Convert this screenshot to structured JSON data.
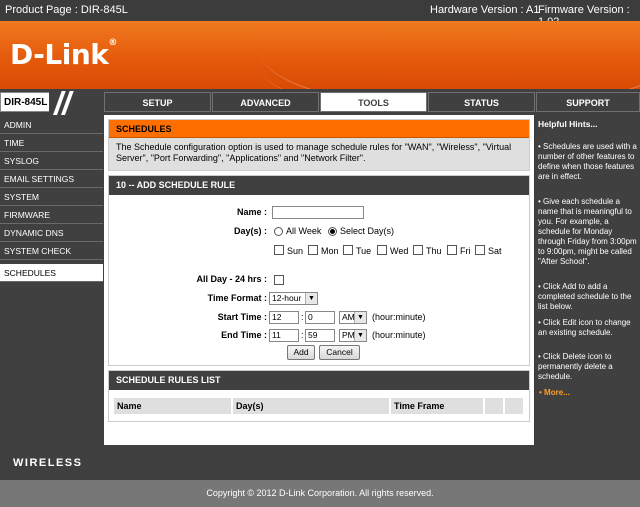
{
  "top_bar": {
    "product_page": "Product Page : DIR-845L",
    "hardware_version": "Hardware Version : A1",
    "firmware_version": "Firmware Version : 1.02"
  },
  "brand": {
    "logo": "D-Link",
    "reg": "®",
    "color": "#e85f10"
  },
  "model_label": "DIR-845L",
  "nav_tabs": [
    {
      "label": "SETUP"
    },
    {
      "label": "ADVANCED"
    },
    {
      "label": "TOOLS"
    },
    {
      "label": "STATUS"
    },
    {
      "label": "SUPPORT"
    }
  ],
  "active_tab": "TOOLS",
  "sidebar": {
    "items": [
      "ADMIN",
      "TIME",
      "SYSLOG",
      "EMAIL SETTINGS",
      "SYSTEM",
      "FIRMWARE",
      "DYNAMIC DNS",
      "SYSTEM CHECK",
      "SCHEDULES"
    ],
    "active": "SCHEDULES"
  },
  "schedules": {
    "title": "SCHEDULES",
    "description": "The Schedule configuration option is used to manage schedule rules for \"WAN\", \"Wireless\", \"Virtual Server\", \"Port Forwarding\", \"Applications\" and \"Network Filter\"."
  },
  "add_rule": {
    "title": "10 -- ADD SCHEDULE RULE",
    "name_label": "Name :",
    "name_value": "",
    "days_label": "Day(s) :",
    "all_week": "All Week",
    "select_days": "Select Day(s)",
    "days": [
      "Sun",
      "Mon",
      "Tue",
      "Wed",
      "Thu",
      "Fri",
      "Sat"
    ],
    "all_day_label": "All Day - 24 hrs :",
    "time_format_label": "Time Format :",
    "time_format_value": "12-hour",
    "start_label": "Start Time :",
    "start_hour": "12",
    "start_min": "0",
    "start_ampm": "AM",
    "end_label": "End Time :",
    "end_hour": "11",
    "end_min": "59",
    "end_ampm": "PM",
    "colon": ":",
    "hint_hm": "(hour:minute)",
    "add_button": "Add",
    "cancel_button": "Cancel"
  },
  "rules_list": {
    "title": "SCHEDULE RULES LIST",
    "columns": [
      "Name",
      "Day(s)",
      "Time Frame"
    ]
  },
  "hints": {
    "title": "Helpful Hints...",
    "items": [
      "• Schedules are used with a number of other features to define when those features are in effect.",
      "• Give each schedule a name that is meaningful to you. For example, a schedule for Monday through Friday from 3:00pm to 9:00pm, might be called \"After School\".",
      "• Click Add to add a completed schedule to the list below.",
      "• Click Edit icon to change an existing schedule.",
      "• Click Delete icon to permanently delete a schedule."
    ],
    "more": "• More..."
  },
  "wireless_label": "WIRELESS",
  "footer": "Copyright © 2012 D-Link Corporation. All rights reserved."
}
